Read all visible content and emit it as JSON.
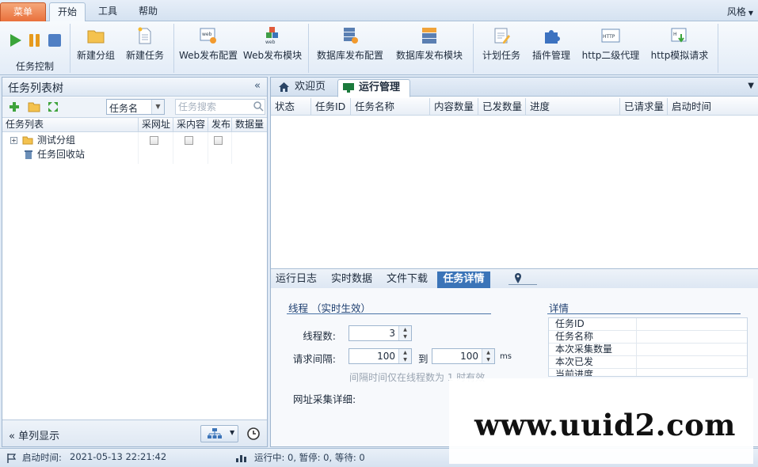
{
  "ribbon_tabs": {
    "menu": "菜单",
    "start": "开始",
    "tools": "工具",
    "help": "帮助",
    "style": "风格"
  },
  "ribbon": {
    "group_task_control": "任务控制",
    "new_group": "新建分组",
    "new_task": "新建任务",
    "web_publish_config": "Web发布配置",
    "web_publish_module": "Web发布模块",
    "db_publish_config": "数据库发布配置",
    "db_publish_module": "数据库发布模块",
    "scheduled_task": "计划任务",
    "plugin_manage": "插件管理",
    "http_proxy": "http二级代理",
    "http_simulate": "http模拟请求"
  },
  "left_panel": {
    "title": "任务列表树",
    "filter_value": "任务名",
    "search_placeholder": "任务搜索",
    "columns": [
      "任务列表",
      "采网址",
      "采内容",
      "发布",
      "数据量"
    ],
    "tree": [
      {
        "label": "测试分组"
      },
      {
        "label": "任务回收站"
      }
    ],
    "footer_single_col": "单列显示"
  },
  "right_panel": {
    "tabs": [
      "欢迎页",
      "运行管理"
    ],
    "grid_columns": [
      "状态",
      "任务ID",
      "任务名称",
      "内容数量",
      "已发数量",
      "进度",
      "已请求量",
      "启动时间"
    ],
    "bottom_tabs": [
      "运行日志",
      "实时数据",
      "文件下载",
      "任务详情"
    ],
    "detail": {
      "thread_title": "线程 （实时生效）",
      "thread_count_label": "线程数:",
      "thread_count": "3",
      "interval_label": "请求间隔:",
      "interval_from": "100",
      "interval_to_label": "到",
      "interval_to": "100",
      "interval_unit": "ms",
      "hint": "间隔时间仅在线程数为 1 时有效",
      "url_detail_label": "网址采集详细:",
      "info_title": "详情",
      "info_rows": [
        "任务ID",
        "任务名称",
        "本次采集数量",
        "本次已发",
        "当前进度"
      ]
    }
  },
  "status": {
    "start_time_label": "启动时间:",
    "start_time": "2021-05-13 22:21:42",
    "counts": "运行中: 0,  暂停: 0,  等待: 0"
  },
  "watermark": "www.uuid2.com",
  "colors": {
    "accent": "#3b74b8",
    "menu_tab": "#e9703b",
    "panel_border": "#9fb6cf"
  }
}
